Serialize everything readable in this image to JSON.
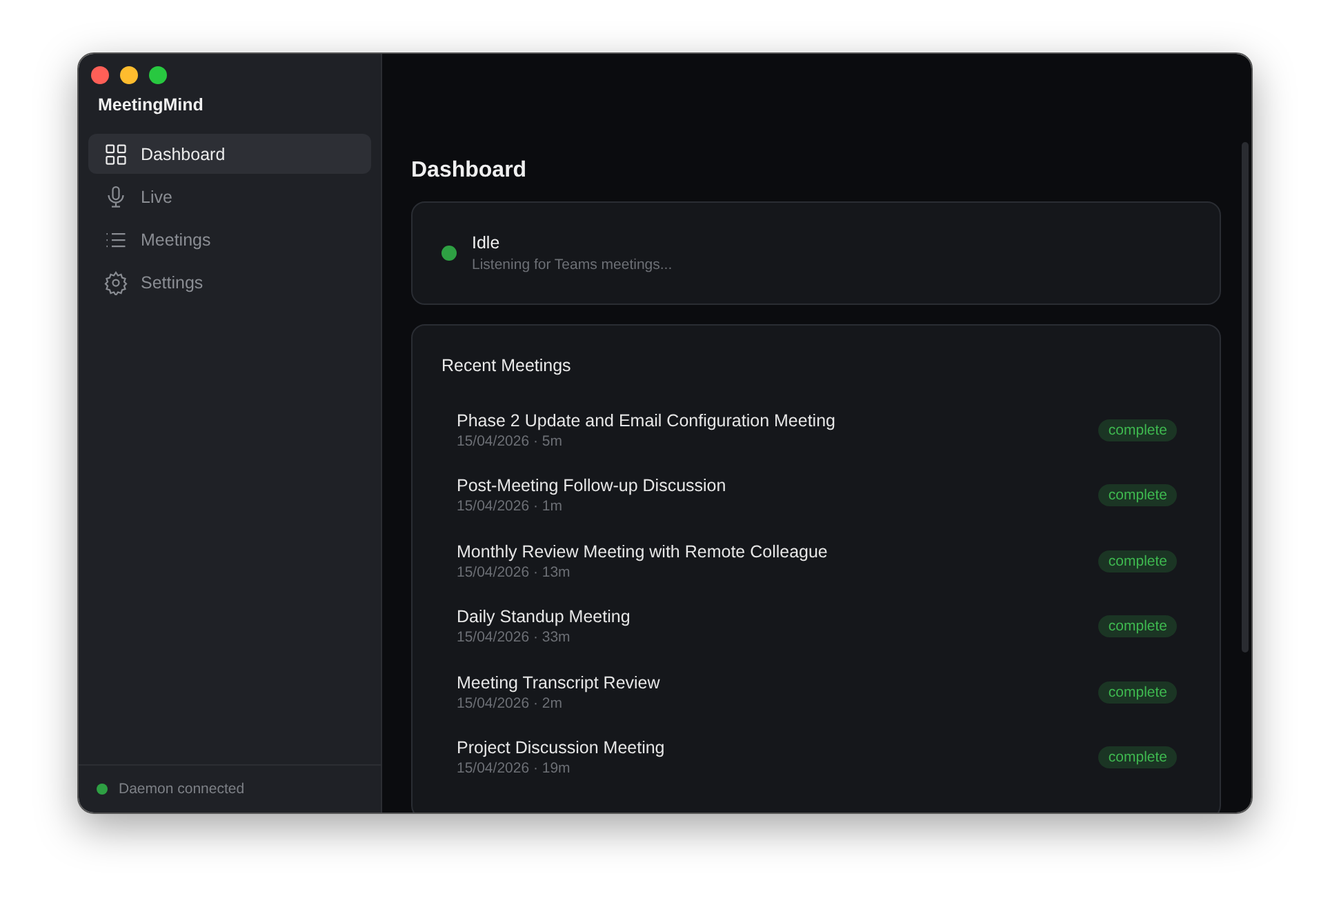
{
  "app": {
    "title": "MeetingMind"
  },
  "sidebar": {
    "items": [
      {
        "label": "Dashboard",
        "selected": true
      },
      {
        "label": "Live",
        "selected": false
      },
      {
        "label": "Meetings",
        "selected": false
      },
      {
        "label": "Settings",
        "selected": false
      }
    ],
    "footer": {
      "text": "Daemon connected",
      "color": "#2ea043"
    }
  },
  "main": {
    "title": "Dashboard",
    "status": {
      "title": "Idle",
      "subtitle": "Listening for Teams meetings...",
      "color": "#2ea043"
    },
    "recent": {
      "title": "Recent Meetings",
      "rows": [
        {
          "title": "Phase 2 Update and Email Configuration Meeting",
          "meta": "15/04/2026 · 5m",
          "status": "complete"
        },
        {
          "title": "Post-Meeting Follow-up Discussion",
          "meta": "15/04/2026 · 1m",
          "status": "complete"
        },
        {
          "title": "Monthly Review Meeting with Remote Colleague",
          "meta": "15/04/2026 · 13m",
          "status": "complete"
        },
        {
          "title": "Daily Standup Meeting",
          "meta": "15/04/2026 · 33m",
          "status": "complete"
        },
        {
          "title": "Meeting Transcript Review",
          "meta": "15/04/2026 · 2m",
          "status": "complete"
        },
        {
          "title": "Project Discussion Meeting",
          "meta": "15/04/2026 · 19m",
          "status": "complete"
        }
      ]
    }
  }
}
